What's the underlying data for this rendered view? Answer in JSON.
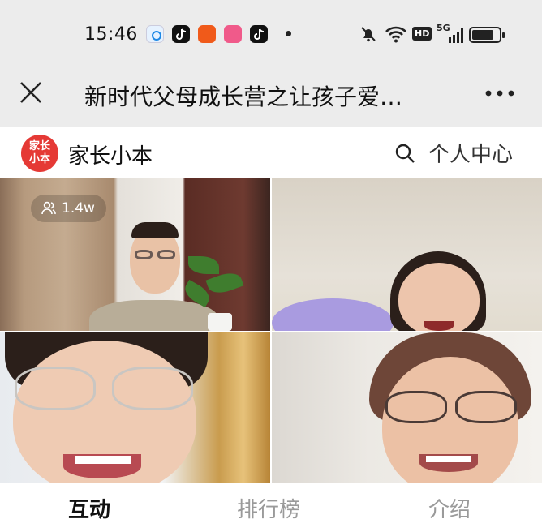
{
  "status_bar": {
    "time": "15:46",
    "hd_badge": "HD",
    "network": "5G"
  },
  "title_bar": {
    "title": "新时代父母成长营之让孩子爱…"
  },
  "site_header": {
    "logo_text_line1": "家长",
    "logo_text_line2": "小本",
    "site_name": "家长小本",
    "personal_center": "个人中心"
  },
  "video": {
    "viewer_count": "1.4w"
  },
  "tabs": [
    {
      "label": "互动"
    },
    {
      "label": "排行榜"
    },
    {
      "label": "介绍"
    }
  ],
  "colors": {
    "brand_red": "#e53935",
    "bar_bg": "#ececec",
    "active_tab": "#111111",
    "inactive_tab": "#9a9a9a"
  }
}
